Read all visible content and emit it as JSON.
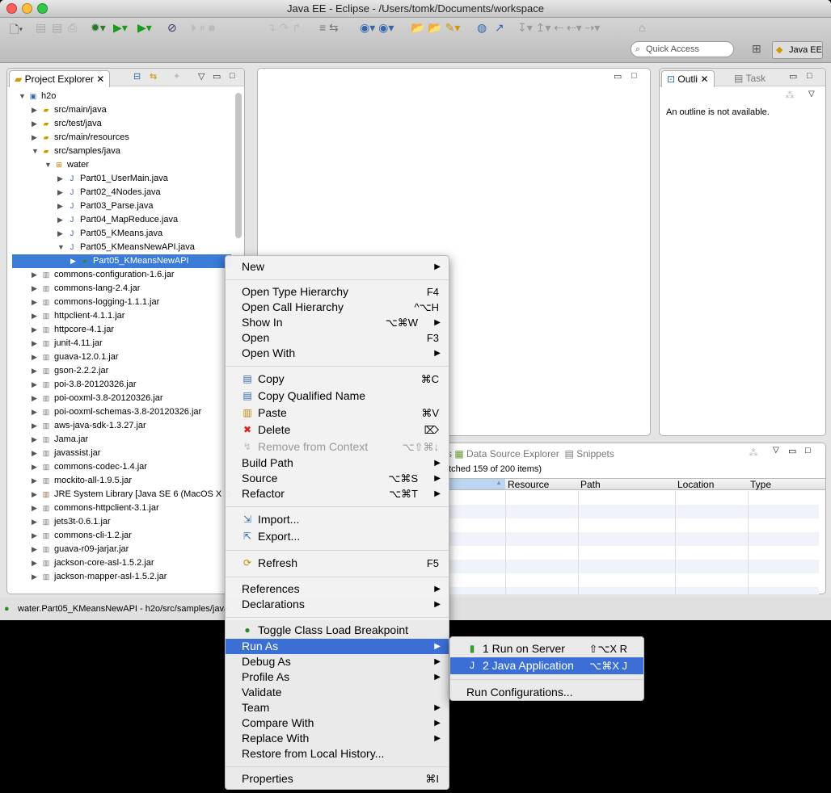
{
  "window": {
    "title": "Java EE - Eclipse - /Users/tomk/Documents/workspace"
  },
  "toolbar": {
    "quick_access_placeholder": "Quick Access",
    "perspective": "Java EE"
  },
  "project_explorer": {
    "tab": "Project Explorer",
    "items": [
      {
        "label": "h2o",
        "level": 0,
        "icon": "project-icon",
        "expanded": true
      },
      {
        "label": "src/main/java",
        "level": 1,
        "icon": "source-folder-icon",
        "expanded": false
      },
      {
        "label": "src/test/java",
        "level": 1,
        "icon": "source-folder-icon",
        "expanded": false
      },
      {
        "label": "src/main/resources",
        "level": 1,
        "icon": "source-folder-icon",
        "expanded": false
      },
      {
        "label": "src/samples/java",
        "level": 1,
        "icon": "source-folder-icon",
        "expanded": true
      },
      {
        "label": "water",
        "level": 2,
        "icon": "package-icon",
        "expanded": true
      },
      {
        "label": "Part01_UserMain.java",
        "level": 3,
        "icon": "java-file-icon",
        "expanded": false
      },
      {
        "label": "Part02_4Nodes.java",
        "level": 3,
        "icon": "java-file-icon",
        "expanded": false
      },
      {
        "label": "Part03_Parse.java",
        "level": 3,
        "icon": "java-file-icon",
        "expanded": false
      },
      {
        "label": "Part04_MapReduce.java",
        "level": 3,
        "icon": "java-file-icon",
        "expanded": false
      },
      {
        "label": "Part05_KMeans.java",
        "level": 3,
        "icon": "java-file-icon",
        "expanded": false
      },
      {
        "label": "Part05_KMeansNewAPI.java",
        "level": 3,
        "icon": "java-file-icon",
        "expanded": true
      },
      {
        "label": "Part05_KMeansNewAPI",
        "level": 4,
        "icon": "class-icon",
        "expanded": false,
        "selected": true
      },
      {
        "label": "commons-configuration-1.6.jar",
        "level": 1,
        "icon": "jar-icon"
      },
      {
        "label": "commons-lang-2.4.jar",
        "level": 1,
        "icon": "jar-icon"
      },
      {
        "label": "commons-logging-1.1.1.jar",
        "level": 1,
        "icon": "jar-icon"
      },
      {
        "label": "httpclient-4.1.1.jar",
        "level": 1,
        "icon": "jar-icon"
      },
      {
        "label": "httpcore-4.1.jar",
        "level": 1,
        "icon": "jar-icon"
      },
      {
        "label": "junit-4.11.jar",
        "level": 1,
        "icon": "jar-icon"
      },
      {
        "label": "guava-12.0.1.jar",
        "level": 1,
        "icon": "jar-icon"
      },
      {
        "label": "gson-2.2.2.jar",
        "level": 1,
        "icon": "jar-icon"
      },
      {
        "label": "poi-3.8-20120326.jar",
        "level": 1,
        "icon": "jar-icon"
      },
      {
        "label": "poi-ooxml-3.8-20120326.jar",
        "level": 1,
        "icon": "jar-icon"
      },
      {
        "label": "poi-ooxml-schemas-3.8-20120326.jar",
        "level": 1,
        "icon": "jar-icon"
      },
      {
        "label": "aws-java-sdk-1.3.27.jar",
        "level": 1,
        "icon": "jar-icon"
      },
      {
        "label": "Jama.jar",
        "level": 1,
        "icon": "jar-icon"
      },
      {
        "label": "javassist.jar",
        "level": 1,
        "icon": "jar-icon"
      },
      {
        "label": "commons-codec-1.4.jar",
        "level": 1,
        "icon": "jar-icon"
      },
      {
        "label": "mockito-all-1.9.5.jar",
        "level": 1,
        "icon": "jar-icon"
      },
      {
        "label": "JRE System Library [Java SE 6 (MacOS X D",
        "level": 1,
        "icon": "library-icon"
      },
      {
        "label": "commons-httpclient-3.1.jar",
        "level": 1,
        "icon": "jar-icon"
      },
      {
        "label": "jets3t-0.6.1.jar",
        "level": 1,
        "icon": "jar-icon"
      },
      {
        "label": "commons-cli-1.2.jar",
        "level": 1,
        "icon": "jar-icon"
      },
      {
        "label": "guava-r09-jarjar.jar",
        "level": 1,
        "icon": "jar-icon"
      },
      {
        "label": "jackson-core-asl-1.5.2.jar",
        "level": 1,
        "icon": "jar-icon"
      },
      {
        "label": "jackson-mapper-asl-1.5.2.jar",
        "level": 1,
        "icon": "jar-icon"
      }
    ]
  },
  "outline": {
    "tab": "Outli",
    "tab2": "Task",
    "message": "An outline is not available."
  },
  "bottom_panel": {
    "tab_partial": "rs",
    "tab_datasource": "Data Source Explorer",
    "tab_snippets": "Snippets",
    "summary": "atched 159 of 200 items)",
    "columns": [
      "Resource",
      "Path",
      "Location",
      "Type"
    ]
  },
  "status_bar": {
    "text": "water.Part05_KMeansNewAPI - h2o/src/samples/java"
  },
  "context_menu": [
    {
      "label": "New",
      "submenu": true
    },
    {
      "sep": true
    },
    {
      "label": "Open Type Hierarchy",
      "shortcut": "F4"
    },
    {
      "label": "Open Call Hierarchy",
      "shortcut": "^⌥H"
    },
    {
      "label": "Show In",
      "shortcut": "⌥⌘W",
      "submenu": true
    },
    {
      "label": "Open",
      "shortcut": "F3"
    },
    {
      "label": "Open With",
      "submenu": true
    },
    {
      "sep": true
    },
    {
      "label": "Copy",
      "shortcut": "⌘C",
      "icon": "copy-icon"
    },
    {
      "label": "Copy Qualified Name",
      "icon": "copy-qualified-name-icon"
    },
    {
      "label": "Paste",
      "shortcut": "⌘V",
      "icon": "paste-icon"
    },
    {
      "label": "Delete",
      "shortcut": "⌦",
      "icon": "delete-icon"
    },
    {
      "label": "Remove from Context",
      "shortcut": "⌥⇧⌘↓",
      "icon": "remove-context-icon",
      "disabled": true
    },
    {
      "label": "Build Path",
      "submenu": true
    },
    {
      "label": "Source",
      "shortcut": "⌥⌘S",
      "submenu": true
    },
    {
      "label": "Refactor",
      "shortcut": "⌥⌘T",
      "submenu": true
    },
    {
      "sep": true
    },
    {
      "label": "Import...",
      "icon": "import-icon"
    },
    {
      "label": "Export...",
      "icon": "export-icon"
    },
    {
      "sep": true
    },
    {
      "label": "Refresh",
      "shortcut": "F5",
      "icon": "refresh-icon"
    },
    {
      "sep": true
    },
    {
      "label": "References",
      "submenu": true
    },
    {
      "label": "Declarations",
      "submenu": true
    },
    {
      "sep": true
    },
    {
      "label": "Toggle Class Load Breakpoint",
      "icon": "class-breakpoint-icon"
    },
    {
      "label": "Run As",
      "submenu": true,
      "highlighted": true
    },
    {
      "label": "Debug As",
      "submenu": true
    },
    {
      "label": "Profile As",
      "submenu": true
    },
    {
      "label": "Validate"
    },
    {
      "label": "Team",
      "submenu": true
    },
    {
      "label": "Compare With",
      "submenu": true
    },
    {
      "label": "Replace With",
      "submenu": true
    },
    {
      "label": "Restore from Local History..."
    },
    {
      "sep": true
    },
    {
      "label": "Properties",
      "shortcut": "⌘I"
    }
  ],
  "run_as_submenu": [
    {
      "label": "1 Run on Server",
      "shortcut": "⇧⌥X R",
      "icon": "server-icon"
    },
    {
      "label": "2 Java Application",
      "shortcut": "⌥⌘X J",
      "icon": "java-app-icon",
      "highlighted": true
    },
    {
      "sep": true
    },
    {
      "label": "Run Configurations..."
    }
  ],
  "colors": {
    "selection": "#3b7cd8",
    "menu_highlight": "#3b6fd6"
  }
}
